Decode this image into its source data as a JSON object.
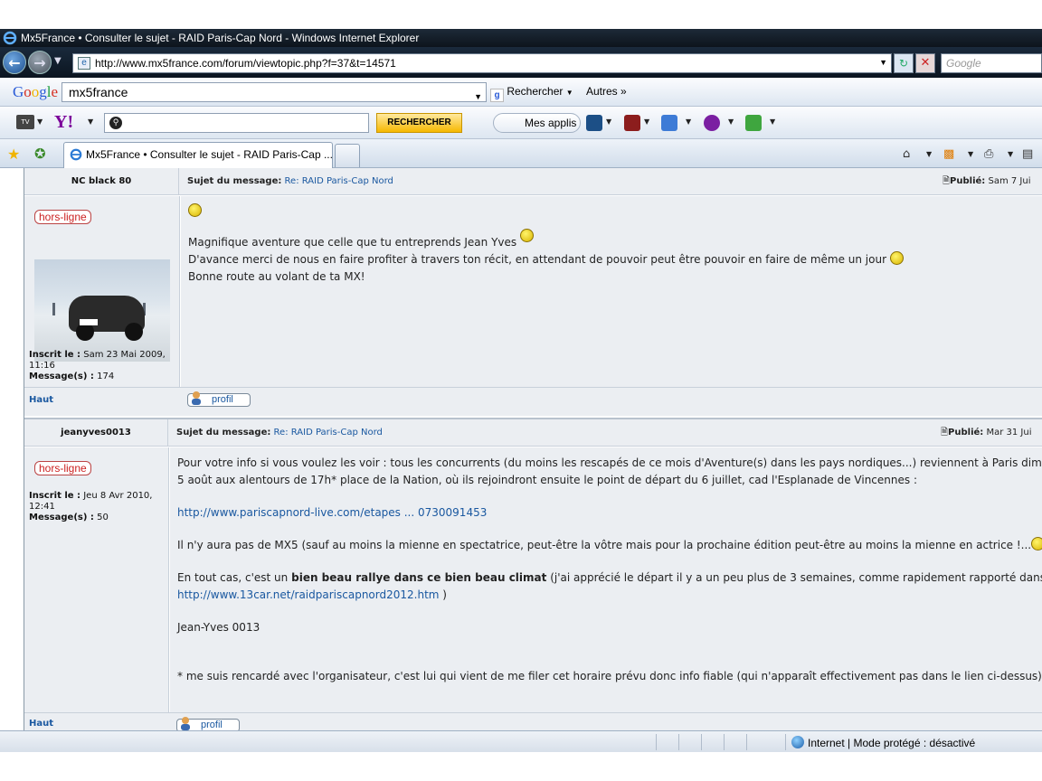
{
  "window": {
    "title": "Mx5France • Consulter le sujet - RAID Paris-Cap Nord - Windows Internet Explorer"
  },
  "address_bar": {
    "url": "http://www.mx5france.com/forum/viewtopic.php?f=37&t=14571",
    "search_placeholder": "Google"
  },
  "google_toolbar": {
    "logo": "Google",
    "query": "mx5france",
    "search_label": "Recherche r",
    "search_button": "Rechercher",
    "more_button": "Autres »"
  },
  "yahoo_toolbar": {
    "logo": "Y!",
    "search_value": "",
    "search_button": "RECHERCHER",
    "apps_button": "Mes applis"
  },
  "tabs": [
    {
      "label": "Mx5France • Consulter le sujet - RAID Paris-Cap ..."
    }
  ],
  "posts": [
    {
      "author": "NC black 80",
      "subject_label": "Sujet du message:",
      "subject": "Re: RAID Paris-Cap Nord",
      "published_label": "Publié:",
      "published": "Sam 7 Jui",
      "status": "hors-ligne",
      "joined_label": "Inscrit le :",
      "joined": "Sam 23 Mai 2009, 11:16",
      "messages_label": "Message(s) :",
      "messages": "174",
      "lines": [
        "Magnifique aventure que celle que tu entreprends Jean Yves",
        "D'avance merci de nous en faire profiter à travers ton récit, en attendant de pouvoir peut être pouvoir en faire de même un jour",
        "Bonne route au volant de ta MX!"
      ],
      "top_link": "Haut",
      "profile_button": "profil"
    },
    {
      "author": "jeanyves0013",
      "subject_label": "Sujet du message:",
      "subject": "Re: RAID Paris-Cap Nord",
      "published_label": "Publié:",
      "published": "Mar 31 Jui",
      "status": "hors-ligne",
      "joined_label": "Inscrit le :",
      "joined": "Jeu 8 Avr 2010, 12:41",
      "messages_label": "Message(s) :",
      "messages": "50",
      "p1a": "Pour votre info si vous voulez les voir : tous les concurrents (du moins les rescapés de ce mois d'Aventure(s) dans les pays nordiques...) reviennent à Paris dimanc",
      "p1b": "5 août aux alentours de 17h* place de la Nation, où ils rejoindront ensuite le point de départ du 6 juillet, cad l'Esplanade de Vincennes :",
      "link1": "http://www.pariscapnord-live.com/etapes ... 0730091453",
      "p2": "Il n'y aura pas de MX5 (sauf au moins la mienne en spectatrice, peut-être la vôtre mais pour la prochaine édition peut-être au moins la mienne en actrice !...",
      "p3a": "En tout cas, c'est un",
      "p3bold": "bien beau rallye dans ce bien beau climat",
      "p3b": "(j'ai apprécié le départ il y a un peu plus de 3 semaines, comme rapidement rapporté dans cette p",
      "link2": "http://www.13car.net/raidpariscapnord2012.htm",
      "link2_suffix": ")",
      "signature": "Jean-Yves 0013",
      "footnote": "* me suis rencardé avec l'organisateur, c'est lui qui vient de me filer cet horaire prévu donc info fiable (qui n'apparaît effectivement pas dans le lien ci-dessus)",
      "top_link": "Haut",
      "profile_button": "profil"
    }
  ],
  "status_bar": {
    "zone": "Internet | Mode protégé : désactivé"
  }
}
